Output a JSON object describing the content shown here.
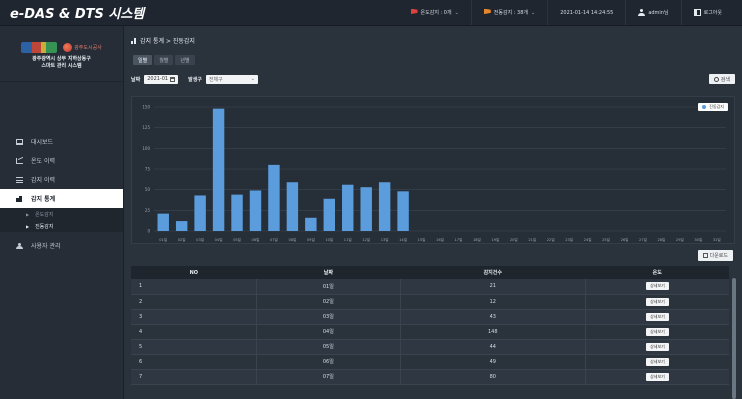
{
  "app": {
    "title": "e-DAS & DTS 시스템"
  },
  "topbar": {
    "items": [
      {
        "label": "온도감지 : 0개",
        "icon": "red-flag-icon"
      },
      {
        "label": "전동감지 : 38개",
        "icon": "orange-flag-icon"
      },
      {
        "label": "2021-01-14 14:24:55"
      },
      {
        "label": "admin님",
        "icon": "user-icon"
      },
      {
        "label": "로그아웃",
        "icon": "logout-icon"
      }
    ]
  },
  "sidebar": {
    "brand_text": "광주광역시 상무 지하상동구\n스마트 관리 시스템",
    "logo_b_text": "광주도시공사",
    "items": [
      {
        "label": "대시보드",
        "icon": "monitor-icon"
      },
      {
        "label": "온도 이력",
        "icon": "chart-icon"
      },
      {
        "label": "감지 이력",
        "icon": "list-icon"
      },
      {
        "label": "감지 통계",
        "icon": "stats-icon"
      },
      {
        "label": "사용자 관리",
        "icon": "user-icon"
      }
    ],
    "subitems": [
      {
        "label": "온도감지"
      },
      {
        "label": "진동감지"
      }
    ]
  },
  "breadcrumb": {
    "text": "감지 통계 > 진동감지"
  },
  "tabs": [
    {
      "label": "일별"
    },
    {
      "label": "월별"
    },
    {
      "label": "년별"
    }
  ],
  "filters": {
    "date_label": "날짜",
    "date_value": "2021-01",
    "section_label": "발생구",
    "section_value": "전체구"
  },
  "buttons": {
    "search": "검색",
    "download": "다운로드",
    "detail": "상세보기"
  },
  "colors": {
    "bar": "#5b9cdd",
    "accent": "#5b9cdd"
  },
  "chart_data": {
    "type": "bar",
    "categories": [
      "01일",
      "02일",
      "03일",
      "04일",
      "05일",
      "06일",
      "07일",
      "08일",
      "09일",
      "10일",
      "11일",
      "12일",
      "13일",
      "14일",
      "15일",
      "16일",
      "17일",
      "18일",
      "19일",
      "20일",
      "21일",
      "22일",
      "23일",
      "24일",
      "25일",
      "26일",
      "27일",
      "28일",
      "29일",
      "30일",
      "31일"
    ],
    "series": [
      {
        "name": "진동감지",
        "values": [
          21,
          12,
          43,
          148,
          44,
          49,
          80,
          59,
          16,
          39,
          56,
          53,
          59,
          48,
          0,
          0,
          0,
          0,
          0,
          0,
          0,
          0,
          0,
          0,
          0,
          0,
          0,
          0,
          0,
          0,
          0
        ]
      }
    ],
    "ylim": [
      0,
      150
    ],
    "yticks": [
      0,
      25,
      50,
      75,
      100,
      125,
      150
    ],
    "grid": true,
    "legend": "top-right"
  },
  "table": {
    "headers": [
      "NO",
      "날짜",
      "감지건수",
      "온도"
    ],
    "rows": [
      {
        "no": "1",
        "date": "01일",
        "count": "21"
      },
      {
        "no": "2",
        "date": "02일",
        "count": "12"
      },
      {
        "no": "3",
        "date": "03일",
        "count": "43"
      },
      {
        "no": "4",
        "date": "04일",
        "count": "148"
      },
      {
        "no": "5",
        "date": "05일",
        "count": "44"
      },
      {
        "no": "6",
        "date": "06일",
        "count": "49"
      },
      {
        "no": "7",
        "date": "07일",
        "count": "80"
      }
    ]
  }
}
